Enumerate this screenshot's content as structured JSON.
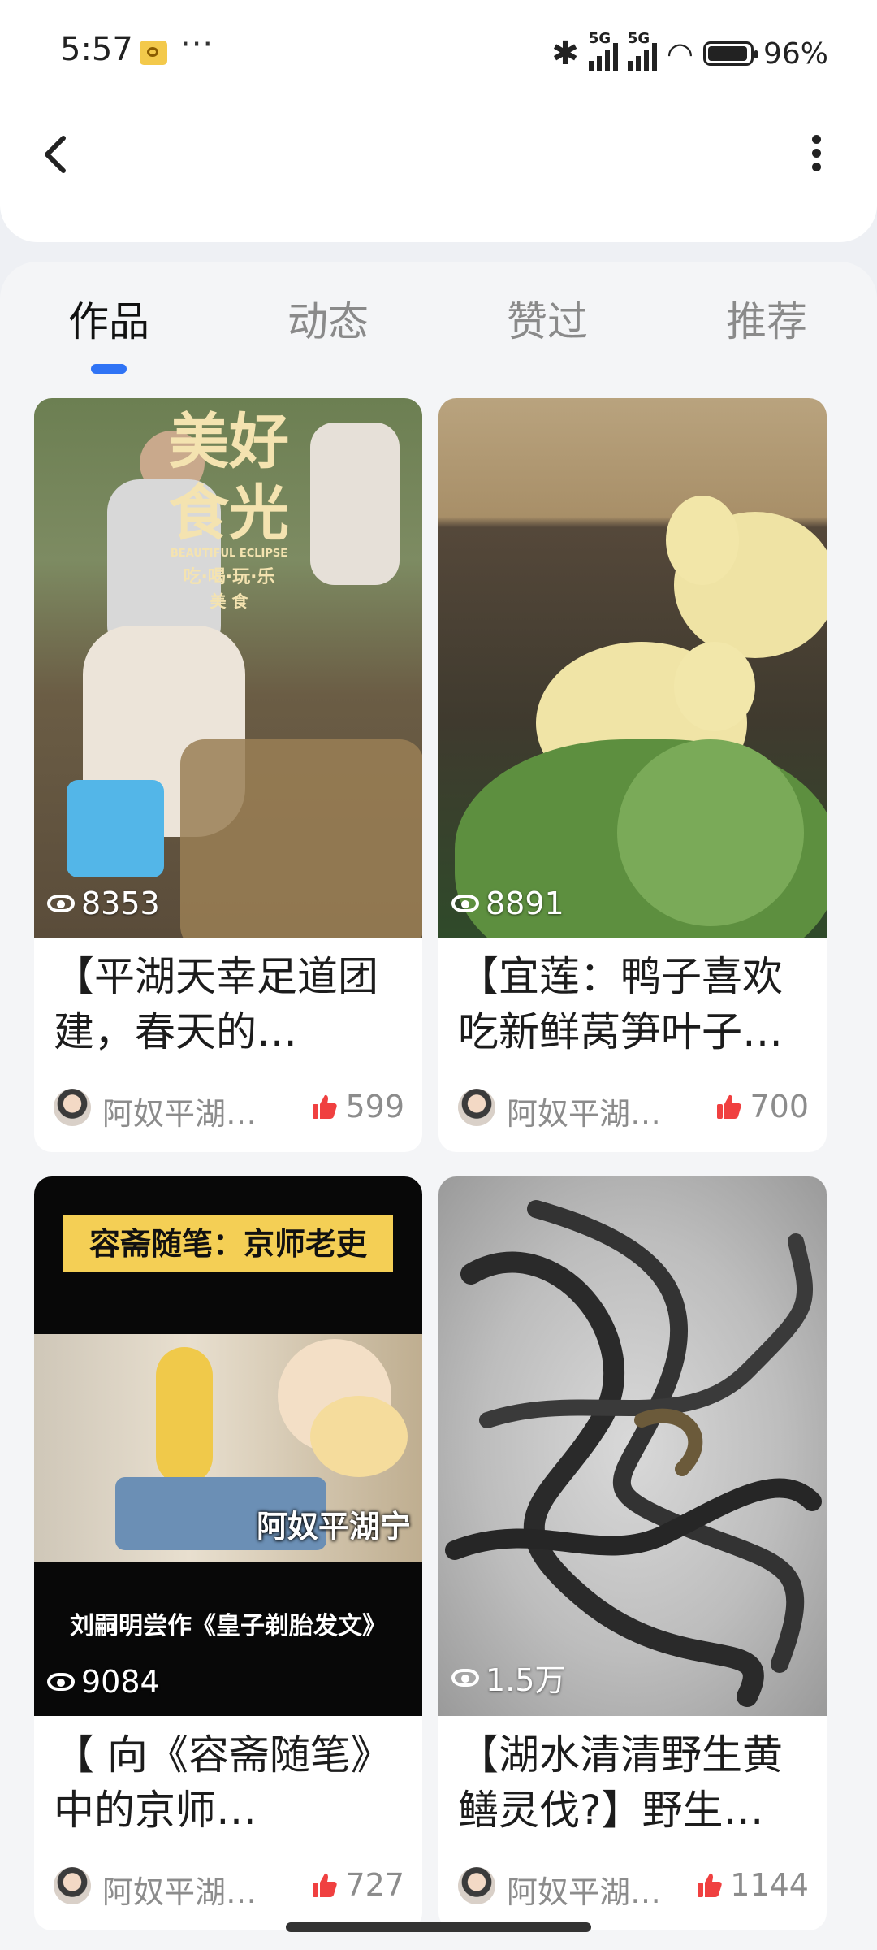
{
  "status_bar": {
    "time": "5:57",
    "more": "···",
    "signal1_label": "5G",
    "signal2_label": "5G",
    "battery_percent": "96%"
  },
  "header": {
    "back_icon": "chevron-left-icon",
    "menu_icon": "more-vertical-icon"
  },
  "tabs": [
    {
      "label": "作品",
      "active": true
    },
    {
      "label": "动态",
      "active": false
    },
    {
      "label": "赞过",
      "active": false
    },
    {
      "label": "推荐",
      "active": false
    }
  ],
  "accent_color": "#2f73f5",
  "like_color": "#f04040",
  "cards": [
    {
      "views": "8353",
      "title": "【平湖天幸足道团建，春天的…",
      "author": "阿奴平湖…",
      "likes": "599",
      "cover": {
        "title": "美好食光",
        "subtitle": "BEAUTIFUL ECLIPSE",
        "tagline": "吃·喝·玩·乐",
        "badge": "美 食"
      }
    },
    {
      "views": "8891",
      "title": "【宜莲：鸭子喜欢吃新鲜莴笋叶子…",
      "author": "阿奴平湖…",
      "likes": "700"
    },
    {
      "views": "9084",
      "title": "【 向《容斋随笔》中的京师…",
      "author": "阿奴平湖…",
      "likes": "727",
      "cover": {
        "banner": "容斋随笔：京师老吏",
        "watermark": "阿奴平湖宁",
        "caption": "刘嗣明尝作《皇子剃胎发文》"
      }
    },
    {
      "views": "1.5万",
      "title": "【湖水清清野生黄鳝灵伐?】野生…",
      "author": "阿奴平湖…",
      "likes": "1144"
    }
  ]
}
